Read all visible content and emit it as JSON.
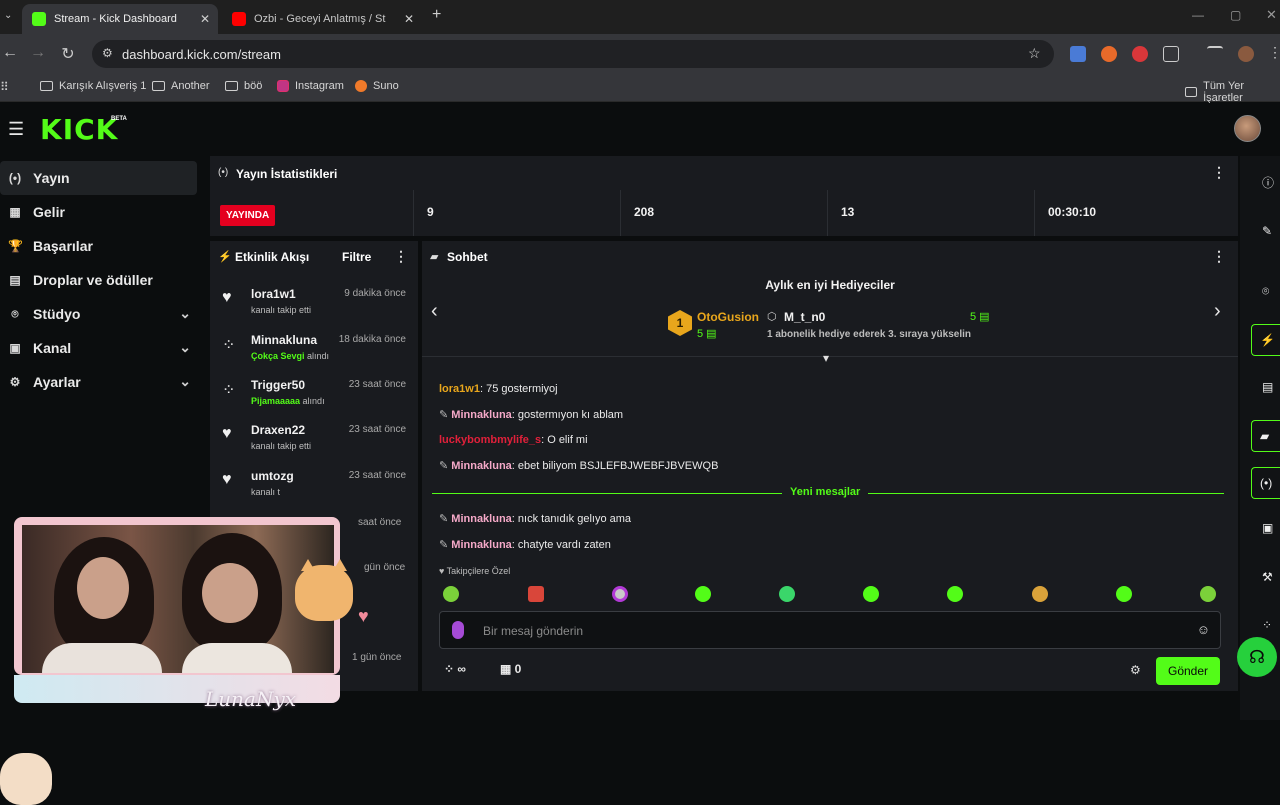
{
  "browser": {
    "tabs": [
      {
        "title": "Stream - Kick Dashboard",
        "active": true,
        "favicon_color": "#53fc18"
      },
      {
        "title": "Ozbi - Geceyi Anlatmış / St",
        "active": false,
        "favicon_color": "#ff0000"
      }
    ],
    "url": "dashboard.kick.com/stream",
    "bookmarks": [
      "Karışık Alışveriş 1",
      "Another",
      "böö",
      "Instagram",
      "Suno"
    ],
    "bookmarks_right": "Tüm Yer İşaretler"
  },
  "app": {
    "logo": "KICK",
    "beta": "BETA"
  },
  "sidebar": {
    "items": [
      {
        "label": "Yayın",
        "icon": "broadcast-icon",
        "glyph": "(•)",
        "active": true
      },
      {
        "label": "Gelir",
        "icon": "revenue-icon",
        "glyph": "▦"
      },
      {
        "label": "Başarılar",
        "icon": "trophy-icon",
        "glyph": "🏆"
      },
      {
        "label": "Droplar ve ödüller",
        "icon": "gift-icon",
        "glyph": "▤"
      },
      {
        "label": "Stüdyo",
        "icon": "studio-icon",
        "glyph": "⌾",
        "expandable": true
      },
      {
        "label": "Kanal",
        "icon": "channel-icon",
        "glyph": "▣",
        "expandable": true
      },
      {
        "label": "Ayarlar",
        "icon": "gear-icon",
        "glyph": "⚙",
        "expandable": true
      }
    ]
  },
  "stats": {
    "title": "Yayın İstatistikleri",
    "live_badge": "YAYINDA",
    "values": [
      "9",
      "208",
      "13",
      "00:30:10"
    ]
  },
  "events": {
    "title": "Etkinlik Akışı",
    "filter": "Filtre",
    "items": [
      {
        "name": "lora1w1",
        "time": "9 dakika önce",
        "desc": "kanalı takip etti",
        "reward": "",
        "icon": "heart-icon",
        "glyph": "♥"
      },
      {
        "name": "Minnakluna",
        "time": "18 dakika önce",
        "reward": "Çokça Sevgi",
        "desc": " alındı",
        "icon": "points-icon",
        "glyph": "⁘"
      },
      {
        "name": "Trigger50",
        "time": "23 saat önce",
        "reward": "Pijamaaaaa",
        "desc": " alındı",
        "icon": "points-icon",
        "glyph": "⁘"
      },
      {
        "name": "Draxen22",
        "time": "23 saat önce",
        "desc": "kanalı takip etti",
        "reward": "",
        "icon": "heart-icon",
        "glyph": "♥"
      },
      {
        "name": "umtozg",
        "time": "23 saat önce",
        "desc": "kanalı t",
        "reward": "",
        "icon": "heart-icon",
        "glyph": "♥"
      }
    ],
    "hidden_times": [
      "saat önce",
      "gün önce",
      "1 gün önce"
    ]
  },
  "chat": {
    "title": "Sohbet",
    "gifters_title": "Aylık en iyi Hediyeciler",
    "gifter1": {
      "rank": "1",
      "name": "OtoGusion",
      "count": "5 ▤"
    },
    "gifter2": {
      "name": "M_t_n0",
      "count": "5 ▤",
      "promo": "1 abonelik hediye ederek 3. sıraya yükselin"
    },
    "messages_before": [
      {
        "user": "lora1w1",
        "text": ": 75 gostermiyoj",
        "color": "#e8a61c",
        "badge": false
      },
      {
        "user": "Minnakluna",
        "text": ": gostermıyon kı ablam",
        "color": "#f5a9c8",
        "badge": true
      },
      {
        "user": "luckybombmylife_s",
        "text": ": O elif mi",
        "color": "#e0203a",
        "badge": false
      },
      {
        "user": "Minnakluna",
        "text": ": ebet biliyom BSJLEFBJWEBFJBVEWQB",
        "color": "#f5a9c8",
        "badge": true
      }
    ],
    "new_messages": "Yeni mesajlar",
    "messages_after": [
      {
        "user": "Minnakluna",
        "text": ": nıck tanıdık gelıyo ama",
        "color": "#f5a9c8",
        "badge": true
      },
      {
        "user": "Minnakluna",
        "text": ": chatyte vardı zaten",
        "color": "#f5a9c8",
        "badge": true
      }
    ],
    "followers_only": "♥ Takipçilere Özel",
    "input_placeholder": "Bir mesaj gönderin",
    "points": "∞",
    "store_count": "0",
    "send_label": "Gönder"
  },
  "overlay": {
    "name": "LunaNyx"
  },
  "colors": {
    "accent": "#53fc18",
    "live": "#e4001f",
    "panel": "#191b1f"
  }
}
